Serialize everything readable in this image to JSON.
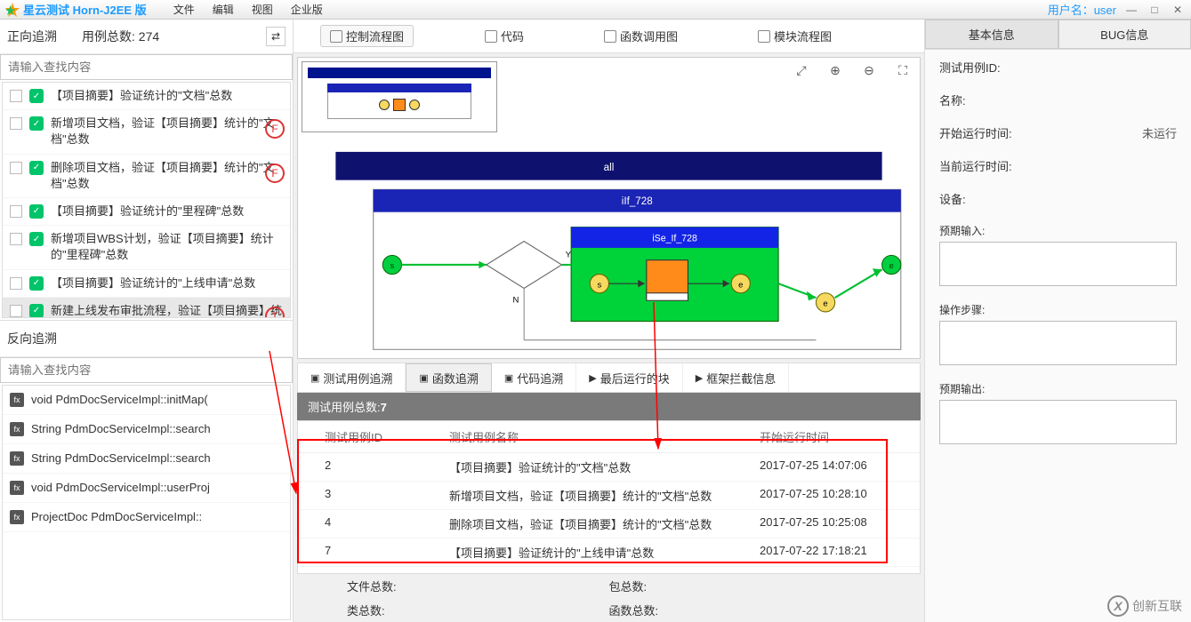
{
  "titlebar": {
    "appname": "星云测试 Horn-J2EE 版",
    "menus": [
      "文件",
      "编辑",
      "视图",
      "企业版"
    ],
    "userlabel": "用户名：",
    "username": "user"
  },
  "left": {
    "forward_title": "正向追溯",
    "count_label": "用例总数:",
    "count_value": "274",
    "search_placeholder": "请输入查找内容",
    "items": [
      {
        "text": "【项目摘要】验证统计的\"文档\"总数",
        "flag": ""
      },
      {
        "text": "新增项目文档，验证【项目摘要】统计的\"文档\"总数",
        "flag": "F"
      },
      {
        "text": "删除项目文档，验证【项目摘要】统计的\"文档\"总数",
        "flag": "F"
      },
      {
        "text": "【项目摘要】验证统计的\"里程碑\"总数",
        "flag": ""
      },
      {
        "text": "新增项目WBS计划，验证【项目摘要】统计的\"里程碑\"总数",
        "flag": ""
      },
      {
        "text": "【项目摘要】验证统计的\"上线申请\"总数",
        "flag": ""
      },
      {
        "text": "新建上线发布审批流程，验证【项目摘要】统计的\"上线申请\"总数",
        "flag": "T",
        "sel": true
      }
    ],
    "reverse_title": "反向追溯",
    "fn_search_placeholder": "请输入查找内容",
    "fns": [
      "void PdmDocServiceImpl::initMap(",
      "String PdmDocServiceImpl::search",
      "String PdmDocServiceImpl::search",
      "void PdmDocServiceImpl::userProj",
      "ProjectDoc PdmDocServiceImpl::"
    ]
  },
  "center": {
    "tabs": [
      "控制流程图",
      "代码",
      "函数调用图",
      "模块流程图"
    ],
    "flow": {
      "label_all": "all",
      "label_if": "iIf_728",
      "label_se": "iSe_If_728"
    },
    "trace_tabs": [
      "测试用例追溯",
      "函数追溯",
      "代码追溯",
      "最后运行的块",
      "框架拦截信息"
    ],
    "total_label": "测试用例总数:",
    "total_value": "7",
    "table": {
      "headers": [
        "测试用例ID",
        "测试用例名称",
        "开始运行时间"
      ],
      "rows": [
        {
          "id": "2",
          "name": "【项目摘要】验证统计的\"文档\"总数",
          "time": "2017-07-25 14:07:06"
        },
        {
          "id": "3",
          "name": "新增项目文档，验证【项目摘要】统计的\"文档\"总数",
          "time": "2017-07-25 10:28:10"
        },
        {
          "id": "4",
          "name": "删除项目文档，验证【项目摘要】统计的\"文档\"总数",
          "time": "2017-07-25 10:25:08"
        },
        {
          "id": "7",
          "name": "【项目摘要】验证统计的\"上线申请\"总数",
          "time": "2017-07-22 17:18:21"
        }
      ]
    },
    "footer": {
      "file_total": "文件总数:",
      "class_total": "类总数:",
      "pkg_total": "包总数:",
      "fn_total": "函数总数:"
    }
  },
  "right": {
    "tabs": [
      "基本信息",
      "BUG信息"
    ],
    "fields": {
      "id_label": "测试用例ID:",
      "name_label": "名称:",
      "start_label": "开始运行时间:",
      "start_value": "未运行",
      "current_label": "当前运行时间:",
      "device_label": "设备:",
      "expected_in_label": "预期输入:",
      "steps_label": "操作步骤:",
      "expected_out_label": "预期输出:"
    }
  },
  "watermark": "创新互联"
}
